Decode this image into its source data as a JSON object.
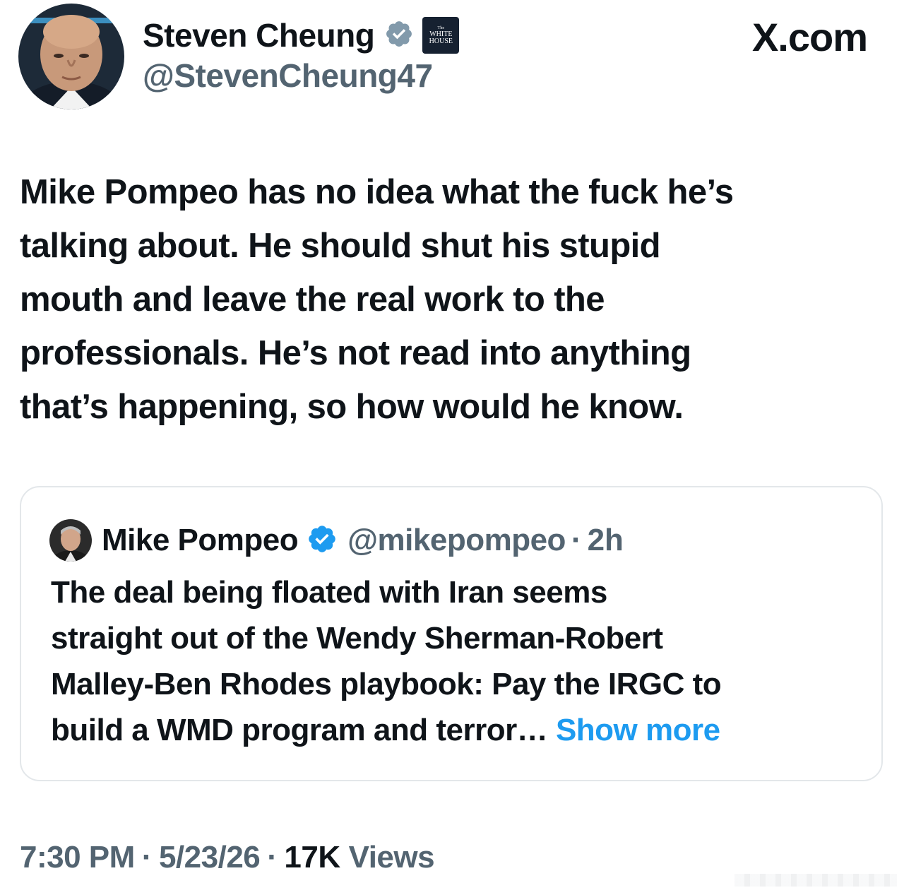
{
  "tweet": {
    "author": {
      "name": "Steven Cheung",
      "handle": "@StevenCheung47",
      "verified": true,
      "verified_color": "#829aab",
      "affiliation_badge": {
        "line1": "The",
        "line2": "WHITE",
        "line3": "HOUSE"
      }
    },
    "site_label": "X.com",
    "text": "Mike Pompeo has no idea what the fuck he’s\ntalking about. He should shut his stupid\nmouth and leave the real work to the\nprofessionals. He’s not read into anything\nthat’s happening, so how would he know.",
    "quote": {
      "author": "Mike Pompeo",
      "handle": "@mikepompeo",
      "separator": "·",
      "time": "2h",
      "verified_color": "#1d9bf0",
      "lines": [
        "The deal being floated with Iran seems",
        "straight out of the Wendy Sherman-Robert",
        "Malley-Ben Rhodes playbook: Pay the IRGC to",
        "build a WMD program and terror…"
      ],
      "show_more": "Show more"
    },
    "meta": {
      "time": "7:30 PM",
      "date": "5/23/26",
      "separator": "·",
      "views_count": "17K",
      "views_label": "Views"
    }
  },
  "colors": {
    "text_primary": "#0f1419",
    "text_secondary": "#536471",
    "link": "#1d9bf0",
    "border": "#e3e7ea"
  }
}
